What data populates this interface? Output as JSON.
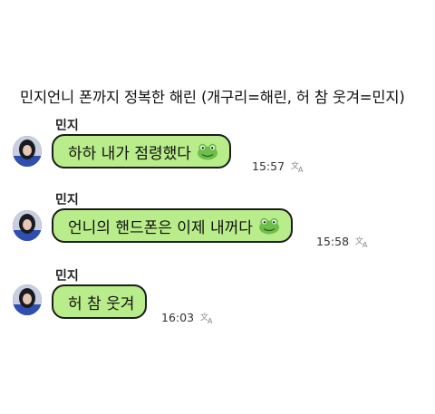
{
  "caption": "민지언니 폰까지 정복한 해린 (개구리=해린, 허 참 웃겨=민지)",
  "messages": [
    {
      "sender": "민지",
      "text": "하하 내가 점령했다",
      "time": "15:57",
      "emoji_icon": "frog-icon"
    },
    {
      "sender": "민지",
      "text": "언니의 핸드폰은 이제 내꺼다",
      "time": "15:58",
      "emoji_icon": "frog-icon"
    },
    {
      "sender": "민지",
      "text": "허 참 웃겨",
      "time": "16:03",
      "emoji_icon": ""
    }
  ],
  "colors": {
    "bubble": "#b9ec8a",
    "bubble_border": "#1c1c1c",
    "frog": "#6cc04a"
  }
}
